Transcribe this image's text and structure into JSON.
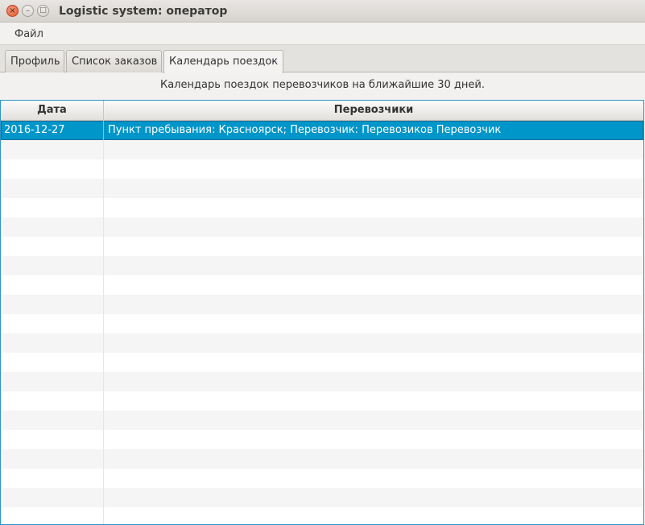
{
  "window": {
    "title": "Logistic system: оператор",
    "close_glyph": "×",
    "min_glyph": "–",
    "max_glyph": "□"
  },
  "menu": {
    "items": [
      {
        "label": "Файл"
      }
    ]
  },
  "tabs": [
    {
      "label": "Профиль",
      "active": false
    },
    {
      "label": "Список заказов",
      "active": false
    },
    {
      "label": "Календарь поездок",
      "active": true
    }
  ],
  "caption": "Календарь поездок перевозчиков на ближайшие 30 дней.",
  "table": {
    "columns": [
      "Дата",
      "Перевозчики"
    ],
    "rows": [
      {
        "date": "2016-12-27",
        "carriers": "Пункт пребывания: Красноярск; Перевозчик: Перевозиков Перевозчик",
        "selected": true
      }
    ]
  },
  "colors": {
    "selection": "#0096c9",
    "table_border": "#2d95c8"
  }
}
